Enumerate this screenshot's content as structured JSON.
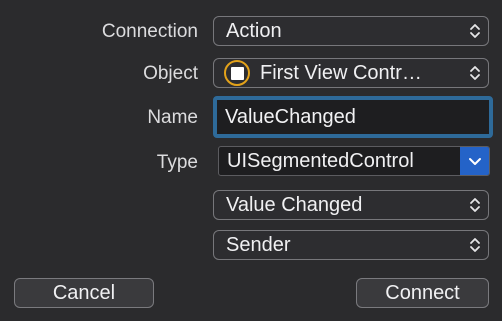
{
  "form": {
    "connection": {
      "label": "Connection",
      "value": "Action"
    },
    "object": {
      "label": "Object",
      "value": "First View Contr…",
      "icon": "view-controller-icon"
    },
    "name": {
      "label": "Name",
      "value": "ValueChanged"
    },
    "type": {
      "label": "Type",
      "value": "UISegmentedControl"
    },
    "event": {
      "value": "Value Changed"
    },
    "arguments": {
      "value": "Sender"
    }
  },
  "buttons": {
    "cancel_label": "Cancel",
    "connect_label": "Connect"
  },
  "colors": {
    "background": "#2b2b2d",
    "focus_ring": "#2e6a99",
    "accent": "#2463c8",
    "object_icon_ring": "#e3a21a"
  }
}
